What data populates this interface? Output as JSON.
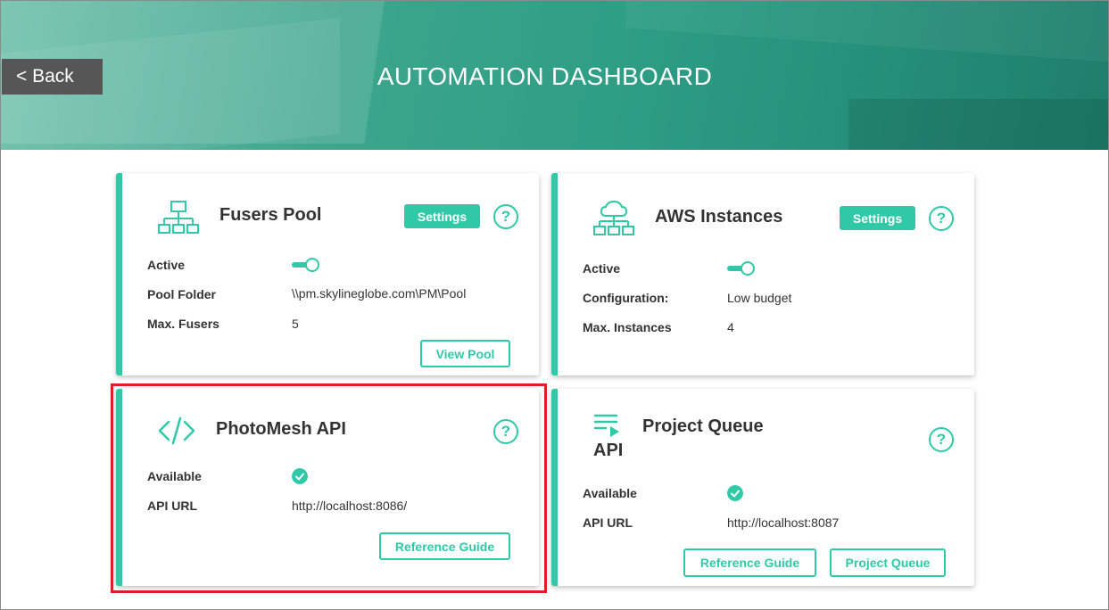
{
  "header": {
    "back_label": "< Back",
    "title": "AUTOMATION DASHBOARD"
  },
  "colors": {
    "accent": "#2fc9a8",
    "header_green": "#2e9e85",
    "highlight_red": "#e11d24",
    "back_button_bg": "#565656"
  },
  "fusers_pool": {
    "title": "Fusers Pool",
    "icon": "network-hierarchy-icon",
    "settings_label": "Settings",
    "help": "?",
    "rows": [
      {
        "label": "Active",
        "toggle": true
      },
      {
        "label": "Pool Folder",
        "value": "\\\\pm.skylineglobe.com\\PM\\Pool"
      },
      {
        "label": "Max. Fusers",
        "value": "5"
      }
    ],
    "action_label": "View Pool"
  },
  "aws_instances": {
    "title": "AWS Instances",
    "icon": "cloud-network-icon",
    "settings_label": "Settings",
    "help": "?",
    "rows": [
      {
        "label": "Active",
        "toggle": true
      },
      {
        "label": "Configuration:",
        "value": "Low budget"
      },
      {
        "label": "Max. Instances",
        "value": "4"
      }
    ]
  },
  "photomesh_api": {
    "title": "PhotoMesh API",
    "icon": "code-icon",
    "help": "?",
    "rows": [
      {
        "label": "Available",
        "status": "check"
      },
      {
        "label": "API URL",
        "value": "http://localhost:8086/"
      }
    ],
    "action_label": "Reference Guide"
  },
  "project_queue": {
    "title": "Project Queue",
    "icon": "queue-list-icon",
    "icon_caption": "API",
    "help": "?",
    "rows": [
      {
        "label": "Available",
        "status": "check"
      },
      {
        "label": "API URL",
        "value": "http://localhost:8087"
      }
    ],
    "actions": [
      "Reference Guide",
      "Project Queue"
    ]
  }
}
